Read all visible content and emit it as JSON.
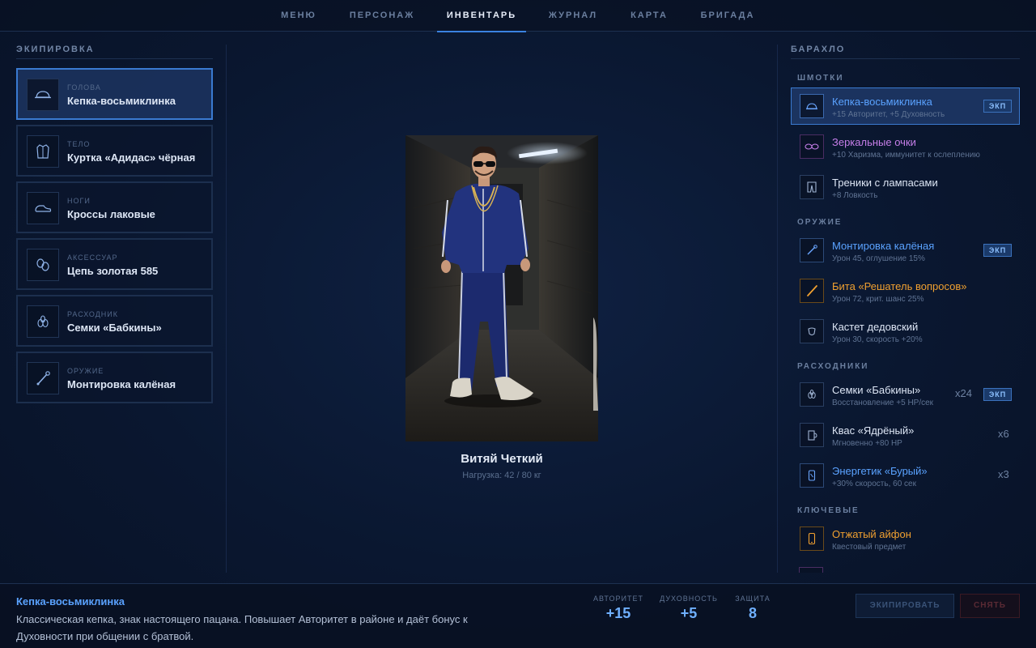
{
  "nav": {
    "tabs": [
      {
        "label": "МЕНЮ"
      },
      {
        "label": "ПЕРСОНАЖ"
      },
      {
        "label": "ИНВЕНТАРЬ",
        "active": true
      },
      {
        "label": "ЖУРНАЛ"
      },
      {
        "label": "КАРТА"
      },
      {
        "label": "БРИГАДА"
      }
    ]
  },
  "equipment": {
    "title": "ЭКИПИРОВКА",
    "slots": [
      {
        "type": "ГОЛОВА",
        "name": "Кепка-восьмиклинка",
        "icon": "cap-icon",
        "active": true
      },
      {
        "type": "ТЕЛО",
        "name": "Куртка «Адидас» чёрная",
        "icon": "jacket-icon"
      },
      {
        "type": "НОГИ",
        "name": "Кроссы лаковые",
        "icon": "sneaker-icon"
      },
      {
        "type": "АКСЕССУАР",
        "name": "Цепь золотая 585",
        "icon": "chain-icon"
      },
      {
        "type": "РАСХОДНИК",
        "name": "Семки «Бабкины»",
        "icon": "seeds-icon"
      },
      {
        "type": "ОРУЖИЕ",
        "name": "Монтировка калёная",
        "icon": "crowbar-icon"
      }
    ]
  },
  "character": {
    "name": "Витяй Четкий",
    "load": "Нагрузка: 42 / 80 кг"
  },
  "inventory": {
    "title": "БАРАХЛО",
    "categories": {
      "clothes": "ШМОТКИ",
      "weapons": "ОРУЖИЕ",
      "consumables": "РАСХОДНИКИ",
      "key": "КЛЮЧЕВЫЕ"
    },
    "clothes": [
      {
        "name": "Кепка-восьмиклинка",
        "desc": "+15 Авторитет, +5 Духовность",
        "badge": "ЭКП",
        "color": "#5aa2ff",
        "icon": "cap-icon"
      },
      {
        "name": "Зеркальные очки",
        "desc": "+10 Харизма, иммунитет к ослеплению",
        "color": "#c57ee8",
        "icon": "glasses-icon"
      },
      {
        "name": "Треники с лампасами",
        "desc": "+8 Ловкость",
        "color": "#dde6f5",
        "icon": "pants-icon"
      }
    ],
    "weapons": [
      {
        "name": "Монтировка калёная",
        "desc": "Урон 45, оглушение 15%",
        "badge": "ЭКП",
        "color": "#5aa2ff",
        "icon": "crowbar-icon"
      },
      {
        "name": "Бита «Решатель вопросов»",
        "desc": "Урон 72, крит. шанс 25%",
        "color": "#f0a030",
        "icon": "bat-icon"
      },
      {
        "name": "Кастет дедовский",
        "desc": "Урон 30, скорость +20%",
        "color": "#dde6f5",
        "icon": "knuckles-icon"
      }
    ],
    "consumables": [
      {
        "name": "Семки «Бабкины»",
        "desc": "Восстановление +5 HP/сек",
        "qty": "x24",
        "badge": "ЭКП",
        "color": "#dde6f5",
        "icon": "seeds-icon"
      },
      {
        "name": "Квас «Ядрёный»",
        "desc": "Мгновенно +80 HP",
        "qty": "x6",
        "color": "#dde6f5",
        "icon": "mug-icon"
      },
      {
        "name": "Энергетик «Бурый»",
        "desc": "+30% скорость, 60 сек",
        "qty": "x3",
        "color": "#5aa2ff",
        "icon": "can-icon"
      }
    ],
    "key": [
      {
        "name": "Отжатый айфон",
        "desc": "Квестовый предмет",
        "color": "#f0a030",
        "icon": "phone-icon"
      }
    ]
  },
  "selected": {
    "title": "Кепка-восьмиклинка",
    "desc": "Классическая кепка, знак настоящего пацана. Повышает Авторитет в районе и даёт бонус к Духовности при общении с братвой.",
    "stats": [
      {
        "label": "АВТОРИТЕТ",
        "value": "+15"
      },
      {
        "label": "ДУХОВНОСТЬ",
        "value": "+5"
      },
      {
        "label": "ЗАЩИТА",
        "value": "8"
      }
    ],
    "equip_label": "ЭКИПИРОВАТЬ",
    "remove_label": "СНЯТЬ"
  }
}
